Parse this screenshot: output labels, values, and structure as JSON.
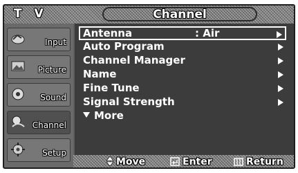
{
  "header": {
    "tv_label": "T V",
    "title": "Channel"
  },
  "sidebar": {
    "items": [
      {
        "label": "Input",
        "icon": "input-icon"
      },
      {
        "label": "Picture",
        "icon": "picture-icon"
      },
      {
        "label": "Sound",
        "icon": "sound-icon"
      },
      {
        "label": "Channel",
        "icon": "channel-icon",
        "active": true
      },
      {
        "label": "Setup",
        "icon": "setup-icon"
      }
    ]
  },
  "menu": {
    "items": [
      {
        "label": "Antenna",
        "value": ": Air",
        "selected": true
      },
      {
        "label": "Auto Program"
      },
      {
        "label": "Channel Manager"
      },
      {
        "label": "Name"
      },
      {
        "label": "Fine Tune"
      },
      {
        "label": "Signal Strength"
      }
    ],
    "more_label": "More"
  },
  "footer": {
    "move_label": "Move",
    "enter_label": "Enter",
    "return_label": "Return"
  }
}
